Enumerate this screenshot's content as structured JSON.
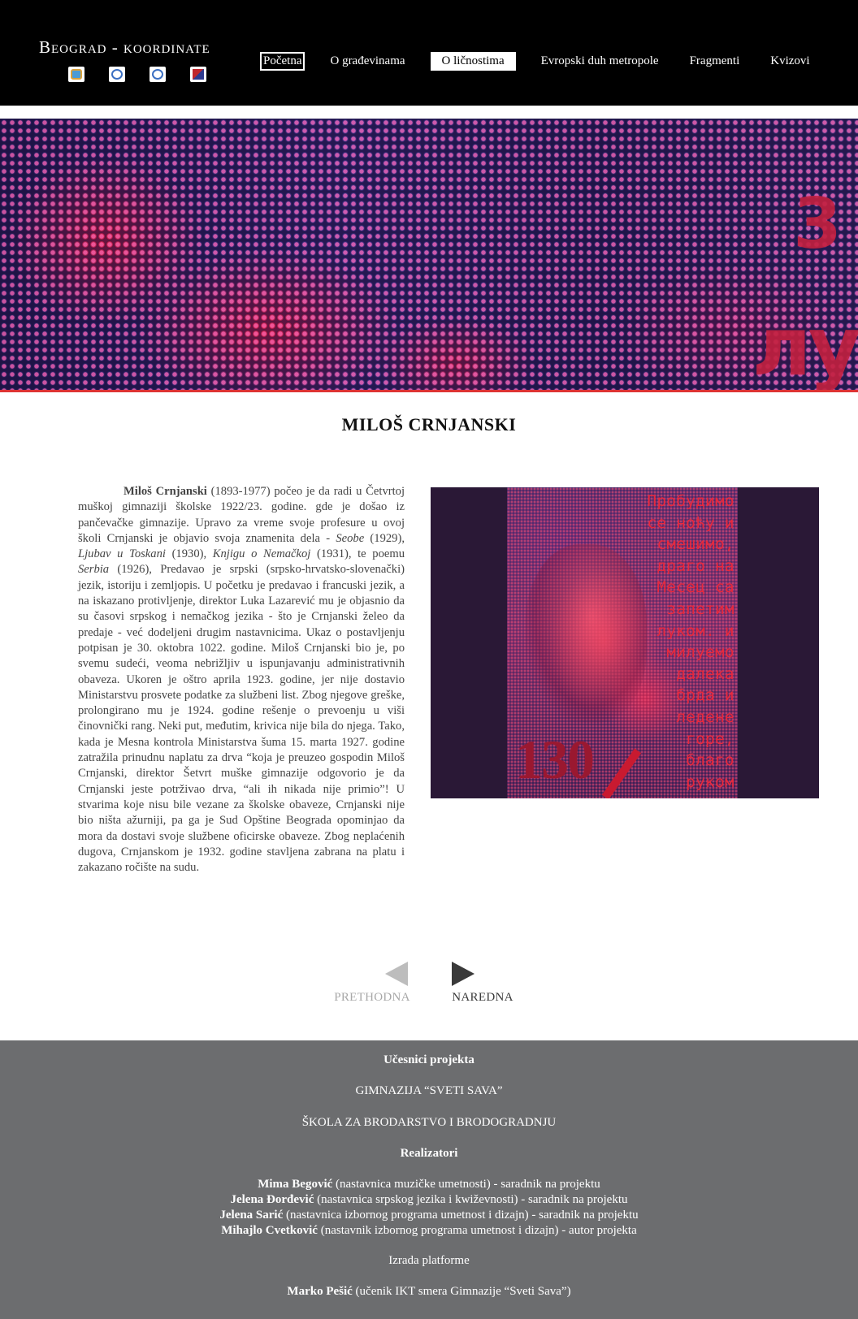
{
  "header": {
    "site_title": "Beograd - koordinate",
    "logos": [
      "school-logo-1",
      "school-logo-2",
      "school-logo-3",
      "school-logo-4"
    ],
    "nav": [
      {
        "label": "Početna",
        "state": "outlined"
      },
      {
        "label": "O građevinama",
        "state": "normal"
      },
      {
        "label": "O ličnostima",
        "state": "active"
      },
      {
        "label": "Evropski duh metropole",
        "state": "normal"
      },
      {
        "label": "Fragmenti",
        "state": "normal"
      },
      {
        "label": "Kvizovi",
        "state": "normal"
      }
    ]
  },
  "banner": {
    "letters_top": "3",
    "letters_bottom": "лу"
  },
  "article": {
    "title": "MILOŠ CRNJANSKI",
    "lead_name": "Miloš Crnjanski",
    "p1": " (1893-1977) počeo je da radi u Četvrtoj muškoj gimnaziji školske 1922/23. godine. gde je došao iz pančevačke gimnazije. Upravo za vreme svoje profesure u ovoj školi Crnjanski je objavio svoja znamenita dela - ",
    "work1": "Seobe",
    "p2": " (1929), ",
    "work2": "Ljubav u Toskani",
    "p3": " (1930), ",
    "work3": "Knjigu o Nemačkoj",
    "p4": " (1931), te poemu ",
    "work4": "Serbia",
    "p5": " (1926), Predavao je srpski (srpsko-hrvatsko-slovenački) jezik, istoriju i zemljopis. U početku je predavao i francuski jezik, a na iskazano protivljenje, direktor Luka Lazarević mu je objasnio da su časovi srpskog i nemačkog jezika - što je Crnjanski želeo da predaje - već dodeljeni drugim nastavnicima. Ukaz o postavljenju potpisan je 30. oktobra 1022. godine. Miloš Crnjanski bio je, po svemu sudeći, veoma nebrižljiv u ispunjavanju administrativnih obaveza. Ukoren je oštro aprila 1923. godine, jer nije dostavio Ministarstvu prosvete podatke za službeni list. Zbog njegove greške, prolongirano mu je 1924. godine rešenje o prevoenju u viši činovnički rang. Neki put, međutim, krivica nije bila do njega. Tako, kada je Mesna kontrola Ministarstva šuma 15. marta 1927. godine zatražila prinudnu naplatu za drva “koja je preuzeo gospodin Miloš Crnjanski, direktor Šetvrt muške gimnazije odgovorio je da Crnjanski jeste potrživao drva, “ali ih nikada nije primio”! U stvarima koje nisu bile vezane za školske obaveze, Crnjanski nije bio ništa ažurniji, pa ga je Sud Opštine Beograda opominjao da mora da dostavi svoje službene oficirske obaveze. Zbog neplaćenih dugova, Crnjanskom je 1932. godine stavljena zabrana na platu i zakazano ročište na sudu."
  },
  "poster": {
    "lines": [
      "Пробудимо",
      "се ноћу и",
      "смешимо,",
      "драго на",
      "Месец са",
      "запетим",
      "луком. и",
      "милуемо",
      "далека",
      "брда и",
      "ледене",
      "горе,",
      "благо",
      "руком"
    ],
    "number": "130"
  },
  "pager": {
    "prev_label": "PRETHODNA",
    "next_label": "NAREDNA"
  },
  "footer": {
    "participants_heading": "Učesnici projekta",
    "school1": "GIMNAZIJA “SVETI SAVA”",
    "school2": "ŠKOLA ZA BRODARSTVO I BRODOGRADNJU",
    "realizers_heading": "Realizatori",
    "credits": [
      {
        "name": "Mima Begović",
        "role": " (nastavnica muzičke umetnosti) - saradnik na projektu"
      },
      {
        "name": "Jelena Đorđević",
        "role": " (nastavnica srpskog jezika i kwiževnosti) - saradnik na projektu"
      },
      {
        "name": "Jelena Sarić",
        "role": " (nastavnica izbornog programa umetnost i dizajn) - saradnik na projektu"
      },
      {
        "name": "Mihajlo Cvetković",
        "role": " (nastavnik izbornog programa umetnost i dizajn) - autor projekta"
      }
    ],
    "platform_heading": "Izrada platforme",
    "platform_credit": {
      "name": "Marko Pešić",
      "role": " (učenik IKT smera Gimnazije “Sveti Sava”)"
    }
  }
}
